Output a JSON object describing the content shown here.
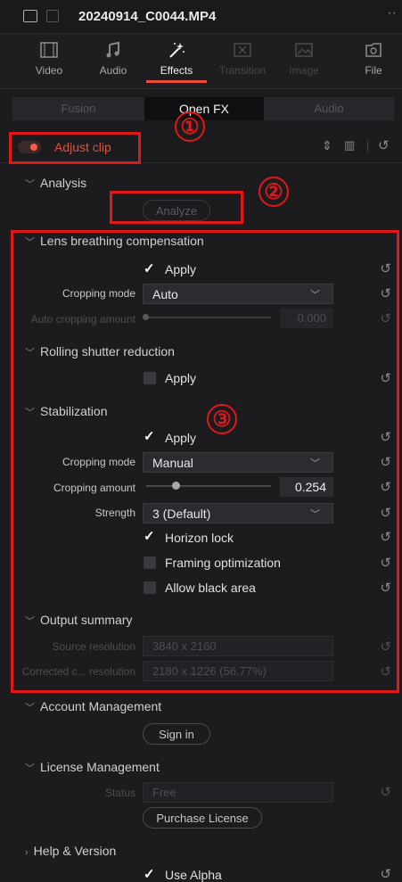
{
  "title_bar": {
    "filename": "20240914_C0044.MP4",
    "more_icon": "ellipsis-icon"
  },
  "tabs": [
    {
      "label": "Video",
      "icon": "video-icon"
    },
    {
      "label": "Audio",
      "icon": "music-note-icon"
    },
    {
      "label": "Effects",
      "icon": "magic-wand-icon"
    },
    {
      "label": "Transition",
      "icon": "transition-icon"
    },
    {
      "label": "Image",
      "icon": "image-icon"
    },
    {
      "label": "File",
      "icon": "file-icon"
    }
  ],
  "subtabs": [
    "Fusion",
    "Open FX",
    "Audio"
  ],
  "effect": {
    "name": "Adjust clip"
  },
  "analysis": {
    "title": "Analysis",
    "analyze_label": "Analyze"
  },
  "lens": {
    "title": "Lens breathing compensation",
    "apply_label": "Apply",
    "cropping_mode_label": "Cropping mode",
    "cropping_mode_value": "Auto",
    "auto_cropping_label": "Auto cropping amount",
    "auto_cropping_value": "0.000"
  },
  "rolling": {
    "title": "Rolling shutter reduction",
    "apply_label": "Apply"
  },
  "stab": {
    "title": "Stabilization",
    "apply_label": "Apply",
    "cropping_mode_label": "Cropping mode",
    "cropping_mode_value": "Manual",
    "cropping_amount_label": "Cropping amount",
    "cropping_amount_value": "0.254",
    "strength_label": "Strength",
    "strength_value": "3 (Default)",
    "horizon_label": "Horizon lock",
    "framing_label": "Framing optimization",
    "black_area_label": "Allow black area"
  },
  "output": {
    "title": "Output summary",
    "source_label": "Source resolution",
    "source_value": "3840 x 2160",
    "corrected_label": "Corrected c... resolution",
    "corrected_value": "2180 x 1226 (56.77%)"
  },
  "account": {
    "title": "Account Management",
    "signin_label": "Sign in"
  },
  "license": {
    "title": "License Management",
    "status_label": "Status",
    "status_value": "Free",
    "purchase_label": "Purchase License"
  },
  "help": {
    "title": "Help & Version",
    "use_alpha_label": "Use Alpha"
  },
  "annotations": {
    "one": "①",
    "two": "②",
    "three": "③"
  },
  "colors": {
    "accent": "#e8503a",
    "annotation_red": "#e01818",
    "background": "#1c1c1f"
  }
}
